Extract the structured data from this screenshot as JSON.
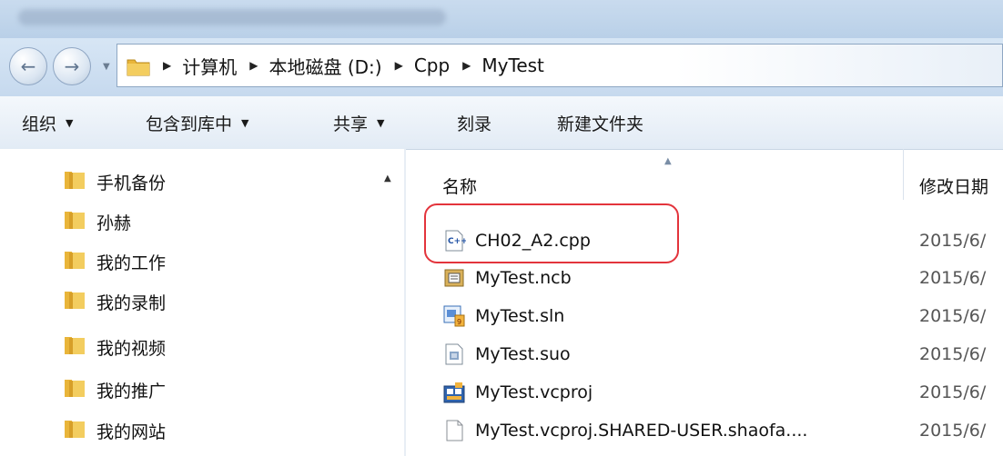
{
  "address": {
    "crumbs": [
      "计算机",
      "本地磁盘 (D:)",
      "Cpp",
      "MyTest"
    ]
  },
  "toolbar": {
    "organize": "组织",
    "include_in_library": "包含到库中",
    "share": "共享",
    "burn": "刻录",
    "new_folder": "新建文件夹"
  },
  "tree": {
    "items": [
      "手机备份",
      "孙赫",
      "我的工作",
      "我的录制",
      "我的视频",
      "我的推广",
      "我的网站"
    ]
  },
  "columns": {
    "name": "名称",
    "date_modified": "修改日期"
  },
  "files": [
    {
      "name": "CH02_A2.cpp",
      "date": "2015/6/",
      "icon": "cpp-file-icon"
    },
    {
      "name": "MyTest.ncb",
      "date": "2015/6/",
      "icon": "ncb-file-icon"
    },
    {
      "name": "MyTest.sln",
      "date": "2015/6/",
      "icon": "sln-file-icon"
    },
    {
      "name": "MyTest.suo",
      "date": "2015/6/",
      "icon": "suo-file-icon"
    },
    {
      "name": "MyTest.vcproj",
      "date": "2015/6/",
      "icon": "vcproj-file-icon"
    },
    {
      "name": "MyTest.vcproj.SHARED-USER.shaofa....",
      "date": "2015/6/",
      "icon": "generic-file-icon"
    }
  ],
  "colors": {
    "highlight": "#e3343c",
    "folder": "#e9b53a"
  }
}
